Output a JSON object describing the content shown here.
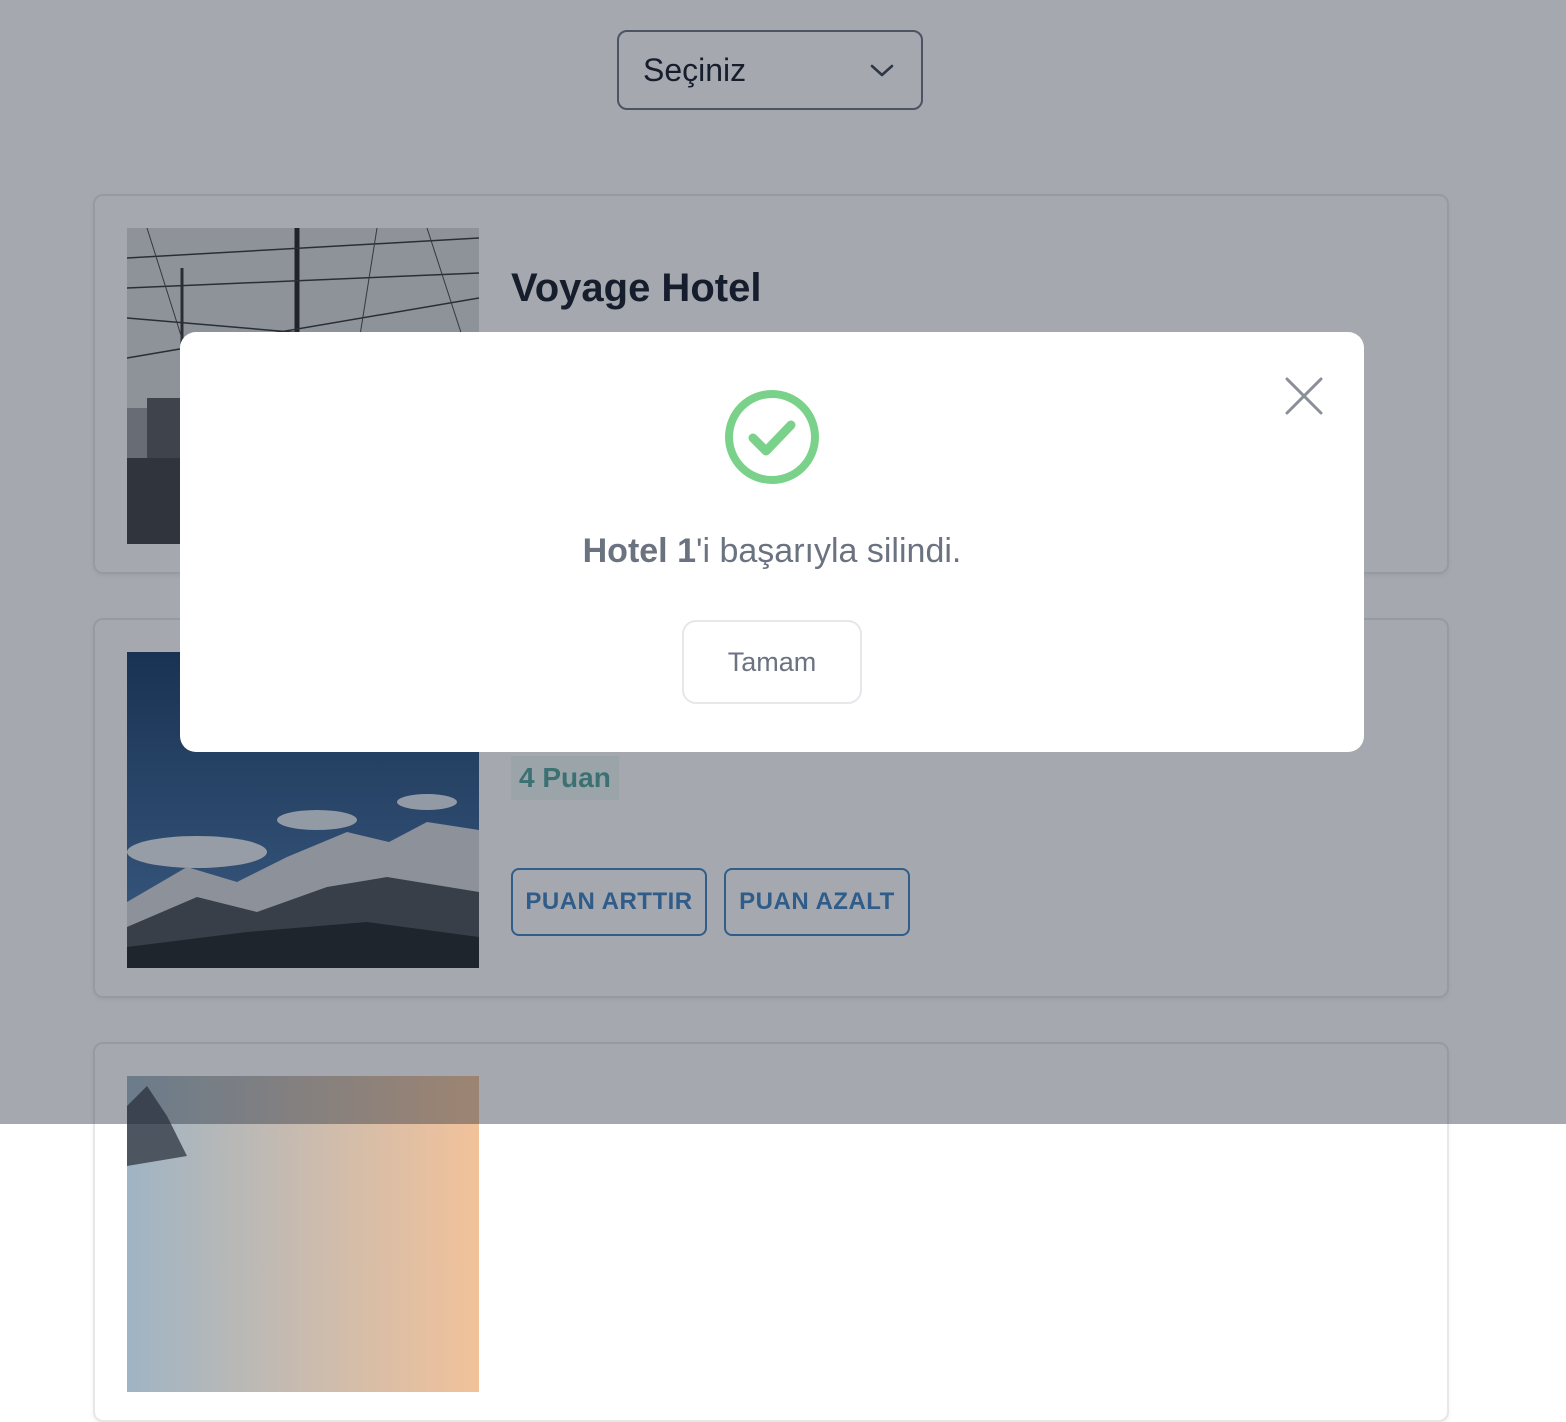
{
  "select": {
    "value": "Seçiniz",
    "icon": "chevron-down-icon"
  },
  "hotels": [
    {
      "name": "Voyage Hotel",
      "image": "power-lines-photo"
    },
    {
      "name": "",
      "score": "4 Puan",
      "increase_label": "PUAN ARTTIR",
      "decrease_label": "PUAN AZALT",
      "image": "snowy-mountains-photo"
    },
    {
      "name": "",
      "image": "sunset-mountain-photo"
    }
  ],
  "modal": {
    "icon": "success-check-icon",
    "hotel_name": "Hotel 1",
    "message_suffix": "'i başarıyla silindi.",
    "ok_label": "Tamam",
    "success_color": "#7ad28a"
  }
}
